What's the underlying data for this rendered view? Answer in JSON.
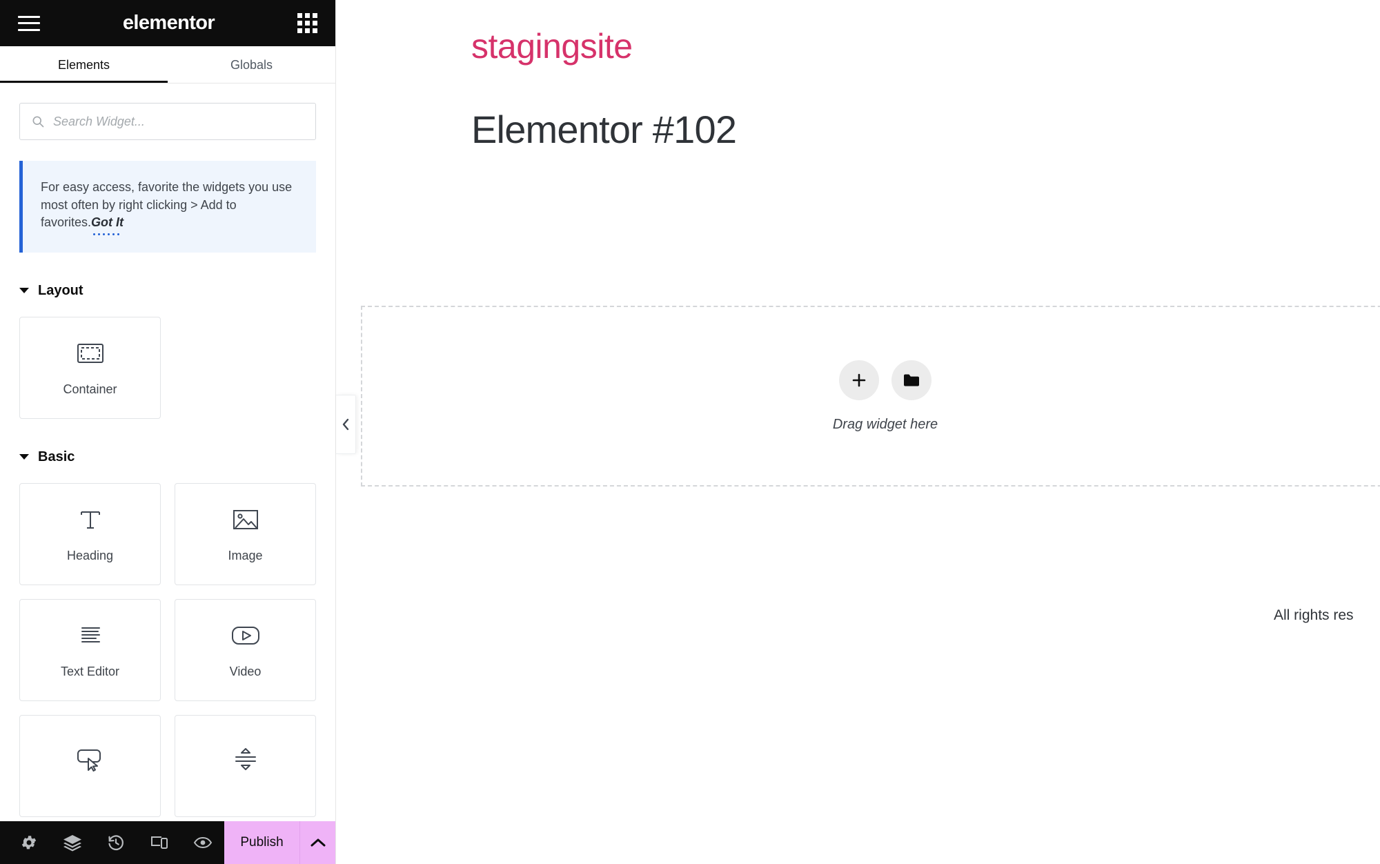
{
  "panel": {
    "brand": "elementor",
    "menu_icon": "hamburger-icon",
    "apps_icon": "grid-apps-icon",
    "tabs": [
      {
        "label": "Elements",
        "active": true
      },
      {
        "label": "Globals",
        "active": false
      }
    ],
    "search": {
      "placeholder": "Search Widget...",
      "value": ""
    },
    "notice": {
      "text": "For easy access, favorite the widgets you use most often by right clicking > Add to favorites.",
      "action_label": "Got It",
      "accent_color": "#2563d6",
      "background": "#eff5fd"
    },
    "sections": [
      {
        "title": "Layout",
        "expanded": true,
        "widgets": [
          {
            "label": "Container",
            "icon": "container-icon"
          }
        ]
      },
      {
        "title": "Basic",
        "expanded": true,
        "widgets": [
          {
            "label": "Heading",
            "icon": "heading-t-icon"
          },
          {
            "label": "Image",
            "icon": "image-icon"
          },
          {
            "label": "Text Editor",
            "icon": "text-editor-icon"
          },
          {
            "label": "Video",
            "icon": "video-play-icon"
          },
          {
            "label": "",
            "icon": "button-cursor-icon"
          },
          {
            "label": "",
            "icon": "divider-icon"
          }
        ]
      }
    ],
    "footer": {
      "tools": [
        {
          "name": "settings-gear-icon"
        },
        {
          "name": "navigator-layers-icon"
        },
        {
          "name": "history-icon"
        },
        {
          "name": "responsive-mode-icon"
        },
        {
          "name": "preview-eye-icon"
        }
      ],
      "publish_label": "Publish",
      "publish_color": "#efb3f7",
      "publish_arrow_icon": "chevron-up-icon"
    },
    "collapse_icon": "chevron-left-icon"
  },
  "canvas": {
    "site_title": "stagingsite",
    "site_title_color": "#d6326a",
    "page_title": "Elementor #102",
    "dropzone": {
      "add_icon": "plus-icon",
      "folder_icon": "folder-icon",
      "label": "Drag widget here"
    },
    "footer_text": "All rights res"
  }
}
